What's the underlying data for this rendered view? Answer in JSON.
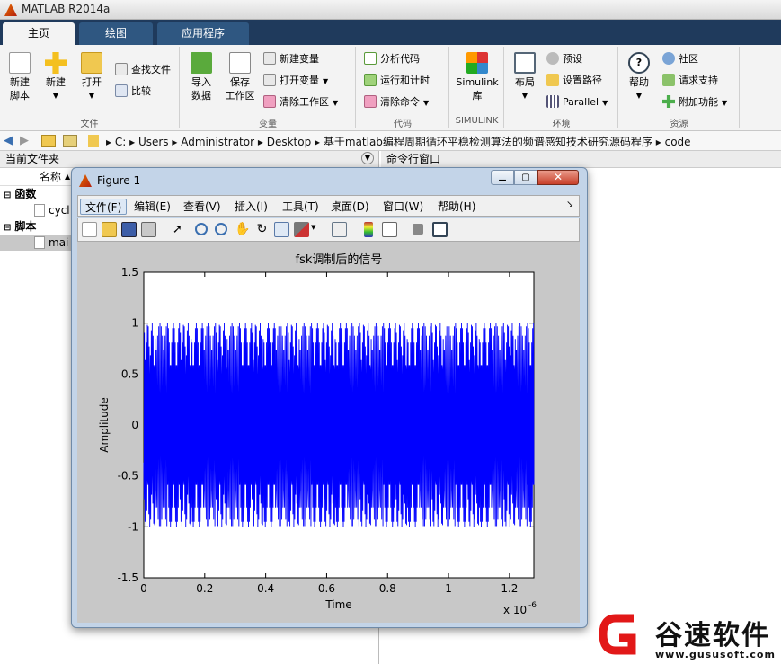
{
  "app": {
    "title": "MATLAB R2014a"
  },
  "tabs": [
    "主页",
    "绘图",
    "应用程序"
  ],
  "ribbon": {
    "file": {
      "new_script": "新建\n脚本",
      "new": "新建",
      "open": "打开",
      "find_files": "查找文件",
      "compare": "比较",
      "label": "文件"
    },
    "variable": {
      "import": "导入\n数据",
      "save_ws": "保存\n工作区",
      "new_var": "新建变量",
      "open_var": "打开变量",
      "clear_ws": "清除工作区",
      "label": "变量"
    },
    "code": {
      "analyze": "分析代码",
      "run_time": "运行和计时",
      "clear_cmd": "清除命令",
      "label": "代码"
    },
    "simulink": {
      "lib": "Simulink\n库",
      "label": "SIMULINK"
    },
    "env": {
      "layout": "布局",
      "prefs": "预设",
      "set_path": "设置路径",
      "parallel": "Parallel",
      "label": "环境"
    },
    "resources": {
      "help": "帮助",
      "community": "社区",
      "support": "请求支持",
      "addons": "附加功能",
      "label": "资源"
    }
  },
  "address": {
    "segments": [
      "C:",
      "Users",
      "Administrator",
      "Desktop",
      "基于matlab编程周期循环平稳检测算法的频谱感知技术研究源码程序",
      "code"
    ]
  },
  "left_panel": {
    "title": "当前文件夹",
    "col_name": "名称",
    "group_functions": "函数",
    "file1": "cycl",
    "group_scripts": "脚本",
    "file2": "mai"
  },
  "right_panel": {
    "title": "命令行窗口"
  },
  "figure": {
    "title": "Figure 1",
    "menu": [
      "文件(F)",
      "编辑(E)",
      "查看(V)",
      "插入(I)",
      "工具(T)",
      "桌面(D)",
      "窗口(W)",
      "帮助(H)"
    ]
  },
  "chart_data": {
    "type": "line",
    "title": "fsk调制后的信号",
    "xlabel": "Time",
    "ylabel": "Amplitude",
    "x_exponent_label": "x 10",
    "x_exponent": "-6",
    "xlim": [
      0,
      1.28
    ],
    "ylim": [
      -1.5,
      1.5
    ],
    "xticks": [
      "0",
      "0.2",
      "0.4",
      "0.6",
      "0.8",
      "1",
      "1.2"
    ],
    "yticks": [
      "1.5",
      "1",
      "0.5",
      "0",
      "-0.5",
      "-1",
      "-1.5"
    ],
    "series": [
      {
        "color": "#0000ff",
        "amplitude": 1,
        "description_samples": "dense oscillation between -1 and 1"
      }
    ]
  },
  "watermark": {
    "brand": "谷速软件",
    "url": "www.gususoft.com"
  },
  "colors": {
    "ribbon_dark": "#1f3a5c",
    "plot_line": "#0000ff"
  }
}
